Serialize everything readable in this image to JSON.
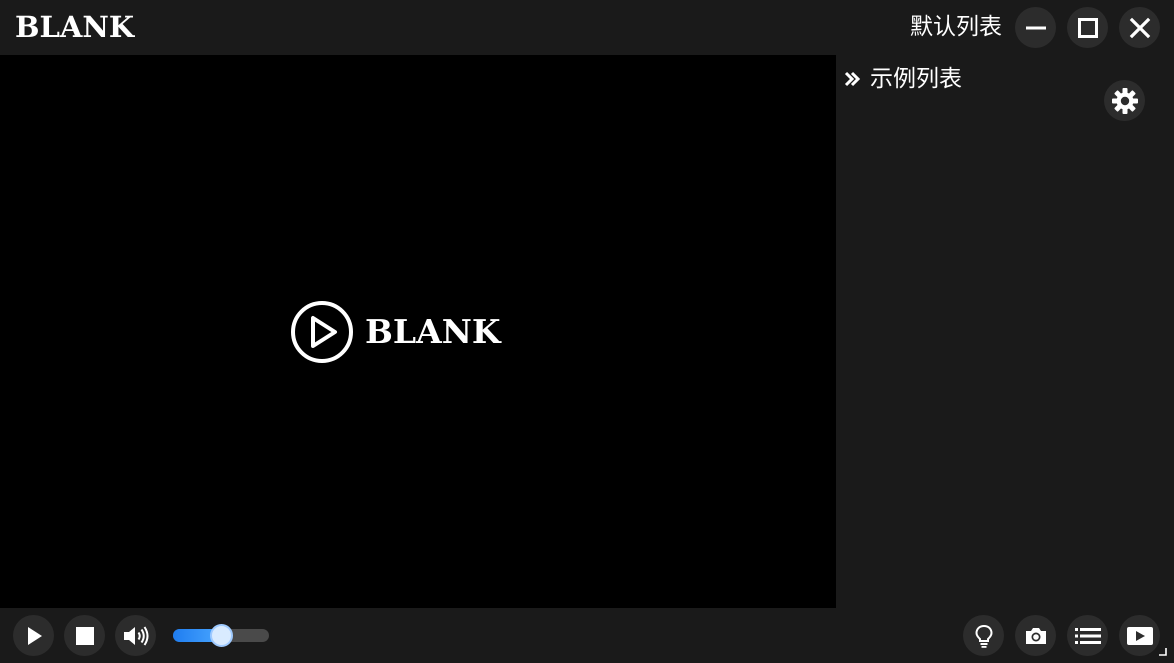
{
  "app": {
    "logo_text": "BLANK"
  },
  "titlebar": {
    "playlist_name": "默认列表",
    "minimize_icon": "minimize-icon",
    "maximize_icon": "maximize-icon",
    "close_icon": "close-icon"
  },
  "video": {
    "logo_text": "BLANK",
    "logo_icon": "play-circle-icon"
  },
  "playlist": {
    "items": [
      {
        "label": "示例列表",
        "icon": "chevron-right-icon"
      }
    ],
    "settings_icon": "gear-icon"
  },
  "controls": {
    "play_icon": "play-icon",
    "stop_icon": "stop-icon",
    "volume_icon": "speaker-icon",
    "volume_level": 0.5,
    "tips_icon": "lightbulb-icon",
    "screenshot_icon": "camera-icon",
    "playlist_icon": "list-icon",
    "media_icon": "play-box-icon"
  },
  "colors": {
    "background": "#1a1a1a",
    "video_background": "#000000",
    "button_background": "#2c2c2c",
    "accent": "#1f7df0"
  }
}
